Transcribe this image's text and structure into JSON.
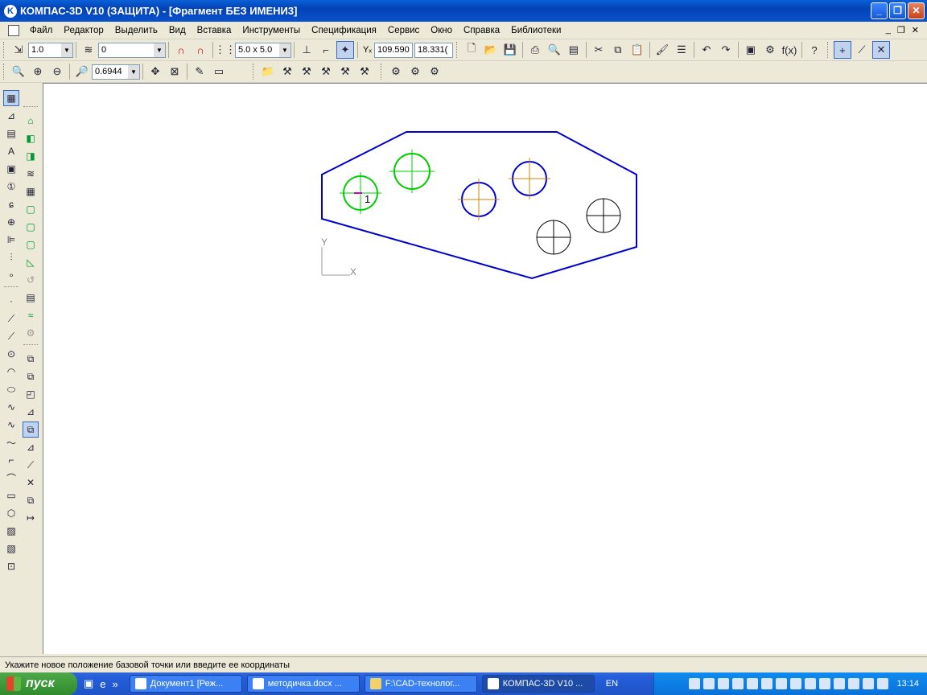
{
  "window": {
    "title": "КОМПАС-3D V10 (ЗАЩИТА) - [Фрагмент БЕЗ ИМЕНИ3]"
  },
  "menu": {
    "items": [
      "Файл",
      "Редактор",
      "Выделить",
      "Вид",
      "Вставка",
      "Инструменты",
      "Спецификация",
      "Сервис",
      "Окно",
      "Справка",
      "Библиотеки"
    ]
  },
  "toolbar1": {
    "scale_value": "1.0",
    "layer_value": "0",
    "grid_step_value": "5.0 x 5.0",
    "coord_x": "109.590",
    "coord_y": "18.331("
  },
  "toolbar2": {
    "zoom_value": "0.6944"
  },
  "drawing": {
    "point_label": "1",
    "axis_x_label": "X",
    "axis_y_label": "Y",
    "colors": {
      "outline": "#0000cc",
      "selected": "#00cc00",
      "center": "#cc8800",
      "plain": "#000000",
      "marker": "#cc00cc"
    }
  },
  "status": {
    "text": "Укажите новое положение базовой точки или введите ее координаты"
  },
  "taskbar": {
    "start_label": "пуск",
    "tasks": [
      "Документ1 [Реж...",
      "методичка.docx ...",
      "F:\\CAD-технолог...",
      "КОМПАС-3D V10 ..."
    ],
    "language": "EN",
    "clock": "13:14"
  }
}
